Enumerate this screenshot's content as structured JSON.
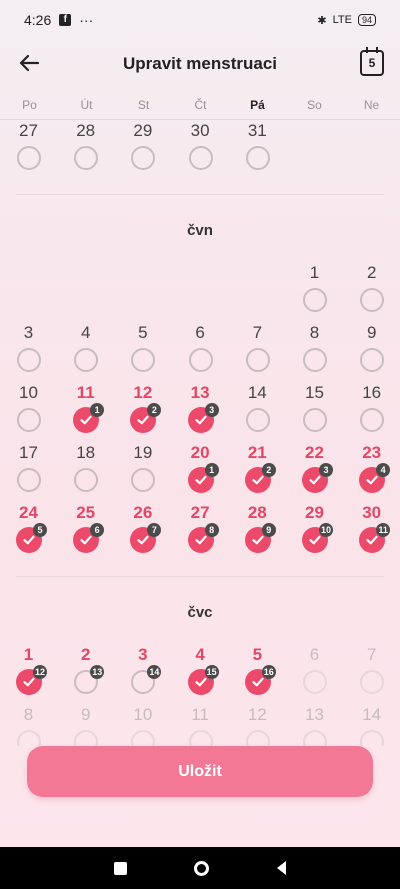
{
  "status": {
    "time": "4:26",
    "dots": "···",
    "network": "LTE",
    "battery": "94"
  },
  "header": {
    "title": "Upravit menstruaci",
    "calendar_day": "5"
  },
  "weekdays": [
    {
      "label": "Po",
      "today": false
    },
    {
      "label": "Út",
      "today": false
    },
    {
      "label": "St",
      "today": false
    },
    {
      "label": "Čt",
      "today": false
    },
    {
      "label": "Pá",
      "today": true
    },
    {
      "label": "So",
      "today": false
    },
    {
      "label": "Ne",
      "today": false
    }
  ],
  "months": [
    {
      "label": "",
      "weeks": [
        [
          {
            "day": "27",
            "state": "empty"
          },
          {
            "day": "28",
            "state": "empty"
          },
          {
            "day": "29",
            "state": "empty"
          },
          {
            "day": "30",
            "state": "empty"
          },
          {
            "day": "31",
            "state": "empty"
          },
          null,
          null
        ]
      ]
    },
    {
      "label": "čvn",
      "weeks": [
        [
          null,
          null,
          null,
          null,
          null,
          {
            "day": "1",
            "state": "empty"
          },
          {
            "day": "2",
            "state": "empty"
          }
        ],
        [
          {
            "day": "3",
            "state": "empty"
          },
          {
            "day": "4",
            "state": "empty"
          },
          {
            "day": "5",
            "state": "empty"
          },
          {
            "day": "6",
            "state": "empty"
          },
          {
            "day": "7",
            "state": "empty"
          },
          {
            "day": "8",
            "state": "empty"
          },
          {
            "day": "9",
            "state": "empty"
          }
        ],
        [
          {
            "day": "10",
            "state": "empty"
          },
          {
            "day": "11",
            "state": "checked",
            "badge": "1"
          },
          {
            "day": "12",
            "state": "checked",
            "badge": "2"
          },
          {
            "day": "13",
            "state": "checked",
            "badge": "3"
          },
          {
            "day": "14",
            "state": "empty"
          },
          {
            "day": "15",
            "state": "empty"
          },
          {
            "day": "16",
            "state": "empty"
          }
        ],
        [
          {
            "day": "17",
            "state": "empty"
          },
          {
            "day": "18",
            "state": "empty"
          },
          {
            "day": "19",
            "state": "empty"
          },
          {
            "day": "20",
            "state": "checked",
            "badge": "1"
          },
          {
            "day": "21",
            "state": "checked",
            "badge": "2"
          },
          {
            "day": "22",
            "state": "checked",
            "badge": "3"
          },
          {
            "day": "23",
            "state": "checked",
            "badge": "4"
          }
        ],
        [
          {
            "day": "24",
            "state": "checked",
            "badge": "5"
          },
          {
            "day": "25",
            "state": "checked",
            "badge": "6"
          },
          {
            "day": "26",
            "state": "checked",
            "badge": "7"
          },
          {
            "day": "27",
            "state": "checked",
            "badge": "8"
          },
          {
            "day": "28",
            "state": "checked",
            "badge": "9"
          },
          {
            "day": "29",
            "state": "checked",
            "badge": "10"
          },
          {
            "day": "30",
            "state": "checked",
            "badge": "11"
          }
        ]
      ]
    },
    {
      "label": "čvc",
      "weeks": [
        [
          {
            "day": "1",
            "state": "checked",
            "badge": "12"
          },
          {
            "day": "2",
            "state": "predicted",
            "badge": "13"
          },
          {
            "day": "3",
            "state": "predicted",
            "badge": "14"
          },
          {
            "day": "4",
            "state": "checked",
            "badge": "15"
          },
          {
            "day": "5",
            "state": "checked",
            "badge": "16"
          },
          {
            "day": "6",
            "state": "future"
          },
          {
            "day": "7",
            "state": "future"
          }
        ],
        [
          {
            "day": "8",
            "state": "future"
          },
          {
            "day": "9",
            "state": "future"
          },
          {
            "day": "10",
            "state": "future"
          },
          {
            "day": "11",
            "state": "future"
          },
          {
            "day": "12",
            "state": "future"
          },
          {
            "day": "13",
            "state": "future"
          },
          {
            "day": "14",
            "state": "future"
          }
        ]
      ]
    }
  ],
  "save_label": "Uložit",
  "colors": {
    "accent": "#ec4a6a",
    "button": "#f27896",
    "badge": "#4b4b4b"
  }
}
